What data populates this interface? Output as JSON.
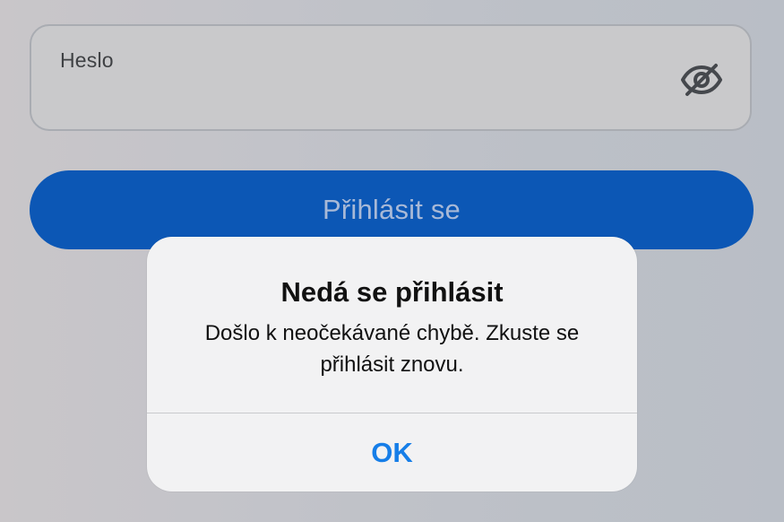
{
  "login_form": {
    "password_label": "Heslo",
    "password_toggle_icon": "eye-off-icon",
    "submit_label": "Přihlásit se"
  },
  "alert": {
    "title": "Nedá se přihlásit",
    "message": "Došlo k neočekávané chybě. Zkuste se přihlásit znovu.",
    "ok_label": "OK"
  },
  "colors": {
    "submit_background": "#0c57b5",
    "submit_text": "#a8b9d7",
    "dialog_background": "#f2f2f3",
    "ok_text": "#167ee8"
  }
}
